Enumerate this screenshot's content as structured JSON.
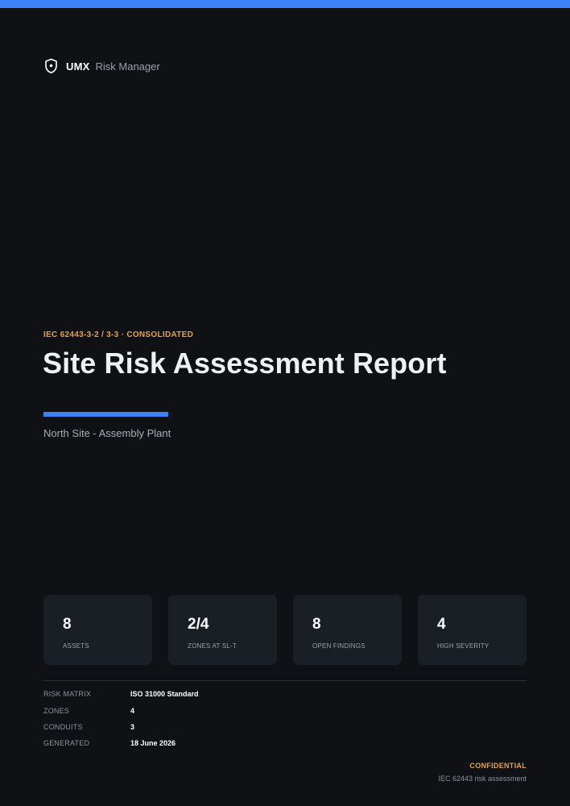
{
  "brand": {
    "name": "UMX",
    "product": "Risk Manager",
    "icon": "shield-icon"
  },
  "cover": {
    "eyebrow": "IEC 62443-3-2 / 3-3 · CONSOLIDATED",
    "title": "Site Risk Assessment Report",
    "subtitle": "North Site - Assembly Plant"
  },
  "stats": [
    {
      "value": "8",
      "label": "ASSETS"
    },
    {
      "value": "2/4",
      "label": "ZONES AT SL-T"
    },
    {
      "value": "8",
      "label": "OPEN FINDINGS"
    },
    {
      "value": "4",
      "label": "HIGH SEVERITY"
    }
  ],
  "meta": [
    {
      "key": "RISK MATRIX",
      "value": "ISO 31000 Standard"
    },
    {
      "key": "ZONES",
      "value": "4"
    },
    {
      "key": "CONDUITS",
      "value": "3"
    },
    {
      "key": "GENERATED",
      "value": "18 June 2026"
    }
  ],
  "footer": {
    "classification": "CONFIDENTIAL",
    "note": "IEC 62443 risk assessment"
  },
  "colors": {
    "background": "#0f1115",
    "accent_blue": "#3b82f6",
    "accent_amber": "#e3a34a",
    "card": "#1a1e25"
  }
}
